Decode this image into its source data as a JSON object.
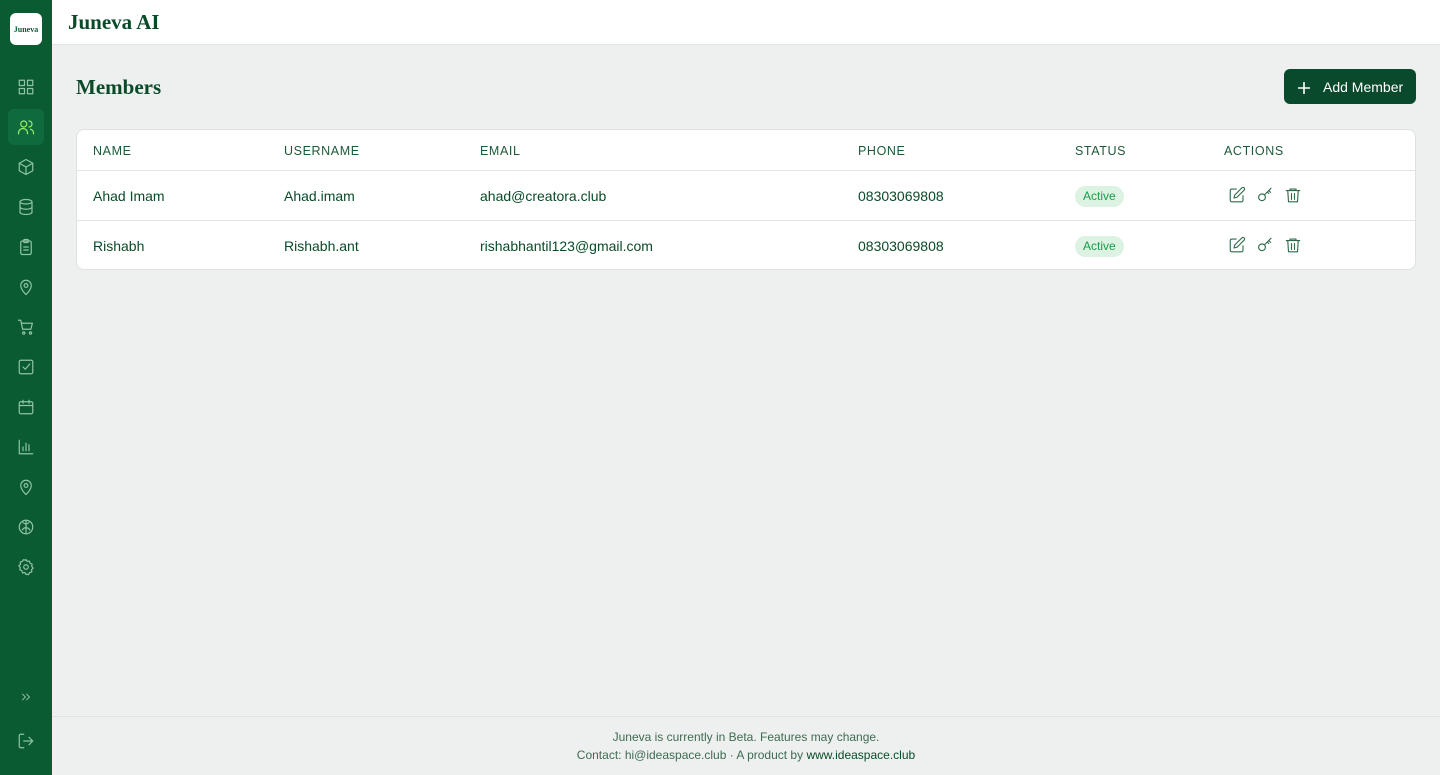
{
  "brand": {
    "logo_text": "Juneva",
    "app_title": "Juneva AI"
  },
  "sidebar": {
    "items": [
      {
        "name": "dashboard"
      },
      {
        "name": "members",
        "active": true
      },
      {
        "name": "products"
      },
      {
        "name": "database"
      },
      {
        "name": "clipboard"
      },
      {
        "name": "location"
      },
      {
        "name": "cart"
      },
      {
        "name": "tasks"
      },
      {
        "name": "calendar"
      },
      {
        "name": "analytics"
      },
      {
        "name": "map-pin"
      },
      {
        "name": "brain"
      },
      {
        "name": "settings"
      }
    ],
    "expand_icon": "chevrons-right-icon",
    "logout_icon": "logout-icon"
  },
  "page": {
    "title": "Members",
    "add_button_label": "Add Member"
  },
  "table": {
    "headers": [
      "NAME",
      "USERNAME",
      "EMAIL",
      "PHONE",
      "STATUS",
      "ACTIONS"
    ],
    "rows": [
      {
        "name": "Ahad Imam",
        "username": "Ahad.imam",
        "email": "ahad@creatora.club",
        "phone": "08303069808",
        "status": "Active"
      },
      {
        "name": "Rishabh",
        "username": "Rishabh.ant",
        "email": "rishabhantil123@gmail.com",
        "phone": "08303069808",
        "status": "Active"
      }
    ],
    "action_icons": [
      "edit-icon",
      "key-icon",
      "trash-icon"
    ]
  },
  "footer": {
    "line1": "Juneva is currently in Beta. Features may change.",
    "line2_prefix": "Contact: hi@ideaspace.club · A product by ",
    "line2_link": "www.ideaspace.club"
  },
  "colors": {
    "sidebar": "#0a5a32",
    "accent": "#9ef06b",
    "primary_button": "#0a4a2c",
    "badge_bg": "#dcf2e3",
    "badge_text": "#1c9c4a"
  }
}
